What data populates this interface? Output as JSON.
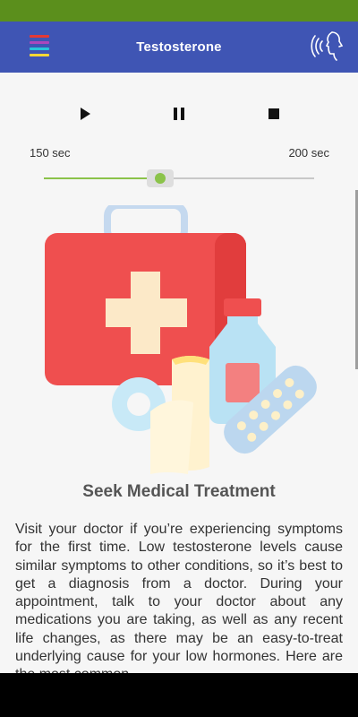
{
  "app_bar": {
    "title": "Testosterone",
    "menu_stripe_colors": [
      "#e53935",
      "#ab47bc",
      "#26c6da",
      "#fdd835"
    ],
    "background": "#3f55b4"
  },
  "status_bar": {
    "color": "#5b8f1c"
  },
  "player": {
    "start_time": "150 sec",
    "end_time": "200 sec",
    "progress_fraction": 0.43,
    "accent_color": "#8bc34a",
    "icons": [
      "play-icon",
      "pause-icon",
      "stop-icon"
    ]
  },
  "content": {
    "illustration": "first-aid-kit-illustration",
    "heading": "Seek Medical Treatment",
    "paragraph": "Visit your doctor if you’re experiencing symptoms for the first time. Low testosterone levels cause similar symptoms to other conditions, so it’s best to get a diagnosis from a doctor. During your appointment, talk to your doctor about any medications you are taking, as well as any recent life changes, as there may be an easy-to-treat underlying cause for your low hormones. Here are the most common"
  }
}
